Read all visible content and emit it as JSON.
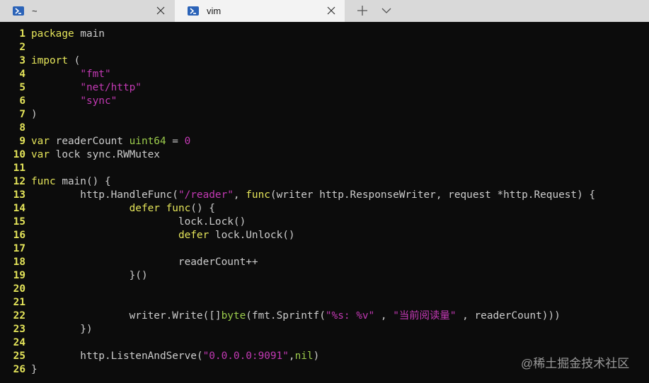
{
  "tabs": [
    {
      "title": "~",
      "icon": "powershell-icon"
    },
    {
      "title": "vim",
      "icon": "powershell-icon",
      "active": true
    }
  ],
  "colors": {
    "keyword": "#e5e55a",
    "string": "#c239b3",
    "type": "#9ccc4c",
    "text": "#cccccc",
    "line_number": "#e5e55a"
  },
  "code_lines": [
    {
      "n": "1",
      "tokens": [
        [
          "k",
          "package"
        ],
        [
          "t",
          " main"
        ]
      ]
    },
    {
      "n": "2",
      "tokens": []
    },
    {
      "n": "3",
      "tokens": [
        [
          "k",
          "import"
        ],
        [
          "t",
          " ("
        ]
      ]
    },
    {
      "n": "4",
      "tokens": [
        [
          "t",
          "        "
        ],
        [
          "s",
          "\"fmt\""
        ]
      ]
    },
    {
      "n": "5",
      "tokens": [
        [
          "t",
          "        "
        ],
        [
          "s",
          "\"net/http\""
        ]
      ]
    },
    {
      "n": "6",
      "tokens": [
        [
          "t",
          "        "
        ],
        [
          "s",
          "\"sync\""
        ]
      ]
    },
    {
      "n": "7",
      "tokens": [
        [
          "t",
          ")"
        ]
      ]
    },
    {
      "n": "8",
      "tokens": []
    },
    {
      "n": "9",
      "tokens": [
        [
          "k",
          "var"
        ],
        [
          "t",
          " readerCount "
        ],
        [
          "y",
          "uint64"
        ],
        [
          "t",
          " = "
        ],
        [
          "s",
          "0"
        ]
      ]
    },
    {
      "n": "10",
      "tokens": [
        [
          "k",
          "var"
        ],
        [
          "t",
          " lock sync.RWMutex"
        ]
      ]
    },
    {
      "n": "11",
      "tokens": []
    },
    {
      "n": "12",
      "tokens": [
        [
          "k",
          "func"
        ],
        [
          "t",
          " main() {"
        ]
      ]
    },
    {
      "n": "13",
      "tokens": [
        [
          "t",
          "        http.HandleFunc("
        ],
        [
          "s",
          "\"/reader\""
        ],
        [
          "t",
          ", "
        ],
        [
          "k",
          "func"
        ],
        [
          "t",
          "(writer http.ResponseWriter, request *http.Request) {"
        ]
      ]
    },
    {
      "n": "14",
      "tokens": [
        [
          "t",
          "                "
        ],
        [
          "k",
          "defer"
        ],
        [
          "t",
          " "
        ],
        [
          "k",
          "func"
        ],
        [
          "t",
          "() {"
        ]
      ]
    },
    {
      "n": "15",
      "tokens": [
        [
          "t",
          "                        lock.Lock()"
        ]
      ]
    },
    {
      "n": "16",
      "tokens": [
        [
          "t",
          "                        "
        ],
        [
          "k",
          "defer"
        ],
        [
          "t",
          " lock.Unlock()"
        ]
      ]
    },
    {
      "n": "17",
      "tokens": []
    },
    {
      "n": "18",
      "tokens": [
        [
          "t",
          "                        readerCount++"
        ]
      ]
    },
    {
      "n": "19",
      "tokens": [
        [
          "t",
          "                }()"
        ]
      ]
    },
    {
      "n": "20",
      "tokens": []
    },
    {
      "n": "21",
      "tokens": []
    },
    {
      "n": "22",
      "tokens": [
        [
          "t",
          "                writer.Write([]"
        ],
        [
          "y",
          "byte"
        ],
        [
          "t",
          "(fmt.Sprintf("
        ],
        [
          "s",
          "\"%s: %v\""
        ],
        [
          "t",
          " , "
        ],
        [
          "s",
          "\"当前阅读量\""
        ],
        [
          "t",
          " , readerCount)))"
        ]
      ]
    },
    {
      "n": "23",
      "tokens": [
        [
          "t",
          "        })"
        ]
      ]
    },
    {
      "n": "24",
      "tokens": []
    },
    {
      "n": "25",
      "tokens": [
        [
          "t",
          "        http.ListenAndServe("
        ],
        [
          "s",
          "\"0.0.0.0:9091\""
        ],
        [
          "t",
          ","
        ],
        [
          "y",
          "nil"
        ],
        [
          "t",
          ")"
        ]
      ]
    },
    {
      "n": "26",
      "tokens": [
        [
          "t",
          "}"
        ]
      ]
    }
  ],
  "watermark": "@稀土掘金技术社区"
}
